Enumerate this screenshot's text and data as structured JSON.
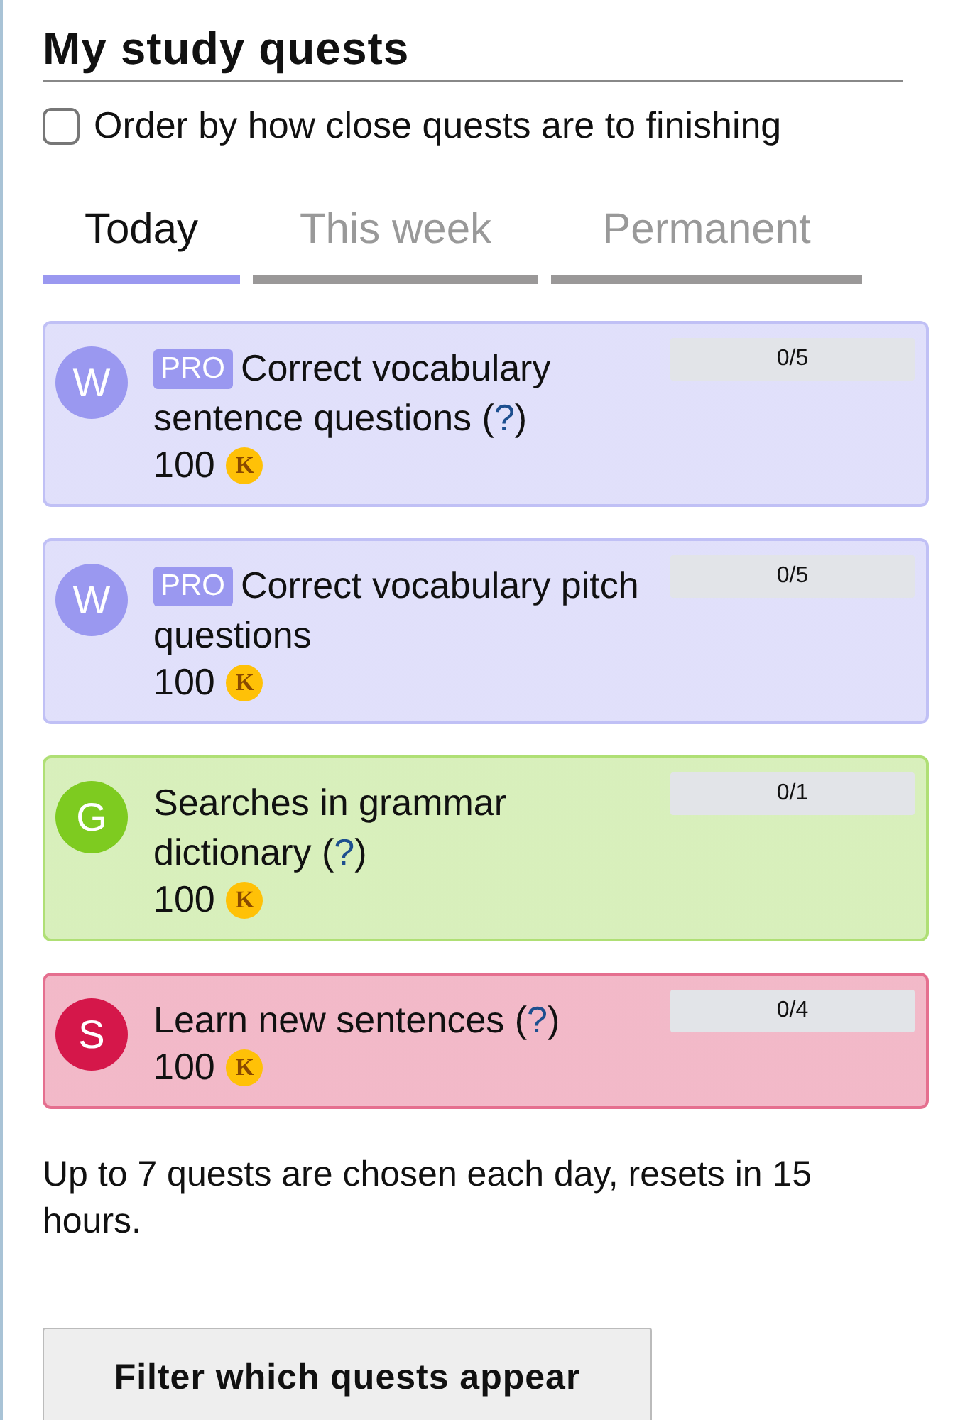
{
  "title": "My study quests",
  "order_option": {
    "label": "Order by how close quests are to finishing",
    "checked": false
  },
  "tabs": [
    {
      "label": "Today",
      "selected": true
    },
    {
      "label": "This week",
      "selected": false
    },
    {
      "label": "Permanent",
      "selected": false
    }
  ],
  "quests": [
    {
      "letter": "W",
      "color": "#9a98f0",
      "badge": "PRO",
      "title": "Correct vocabulary sentence questions (",
      "help": "?",
      "title_end": ")",
      "reward": "100",
      "coin": "K",
      "progress": "0/5",
      "level": 0
    },
    {
      "letter": "W",
      "color": "#9a98f0",
      "badge": "PRO",
      "title": "Correct vocabulary pitch questions",
      "reward": "100",
      "coin": "K",
      "progress": "0/5",
      "level": 0
    },
    {
      "letter": "G",
      "color": "#7ecb20",
      "title": "Searches in grammar dictionary (",
      "help": "?",
      "title_end": ")",
      "reward": "100",
      "coin": "K",
      "progress": "0/1",
      "level": 0
    },
    {
      "letter": "S",
      "color": "#d5174a",
      "title": "Learn new sentences (",
      "help": "?",
      "title_end": ")",
      "reward": "100",
      "coin": "K",
      "progress": "0/4",
      "level": 0
    }
  ],
  "footer_note": "Up to 7 quests are chosen each day, resets in 15 hours.",
  "filter_button": "Filter which quests appear"
}
